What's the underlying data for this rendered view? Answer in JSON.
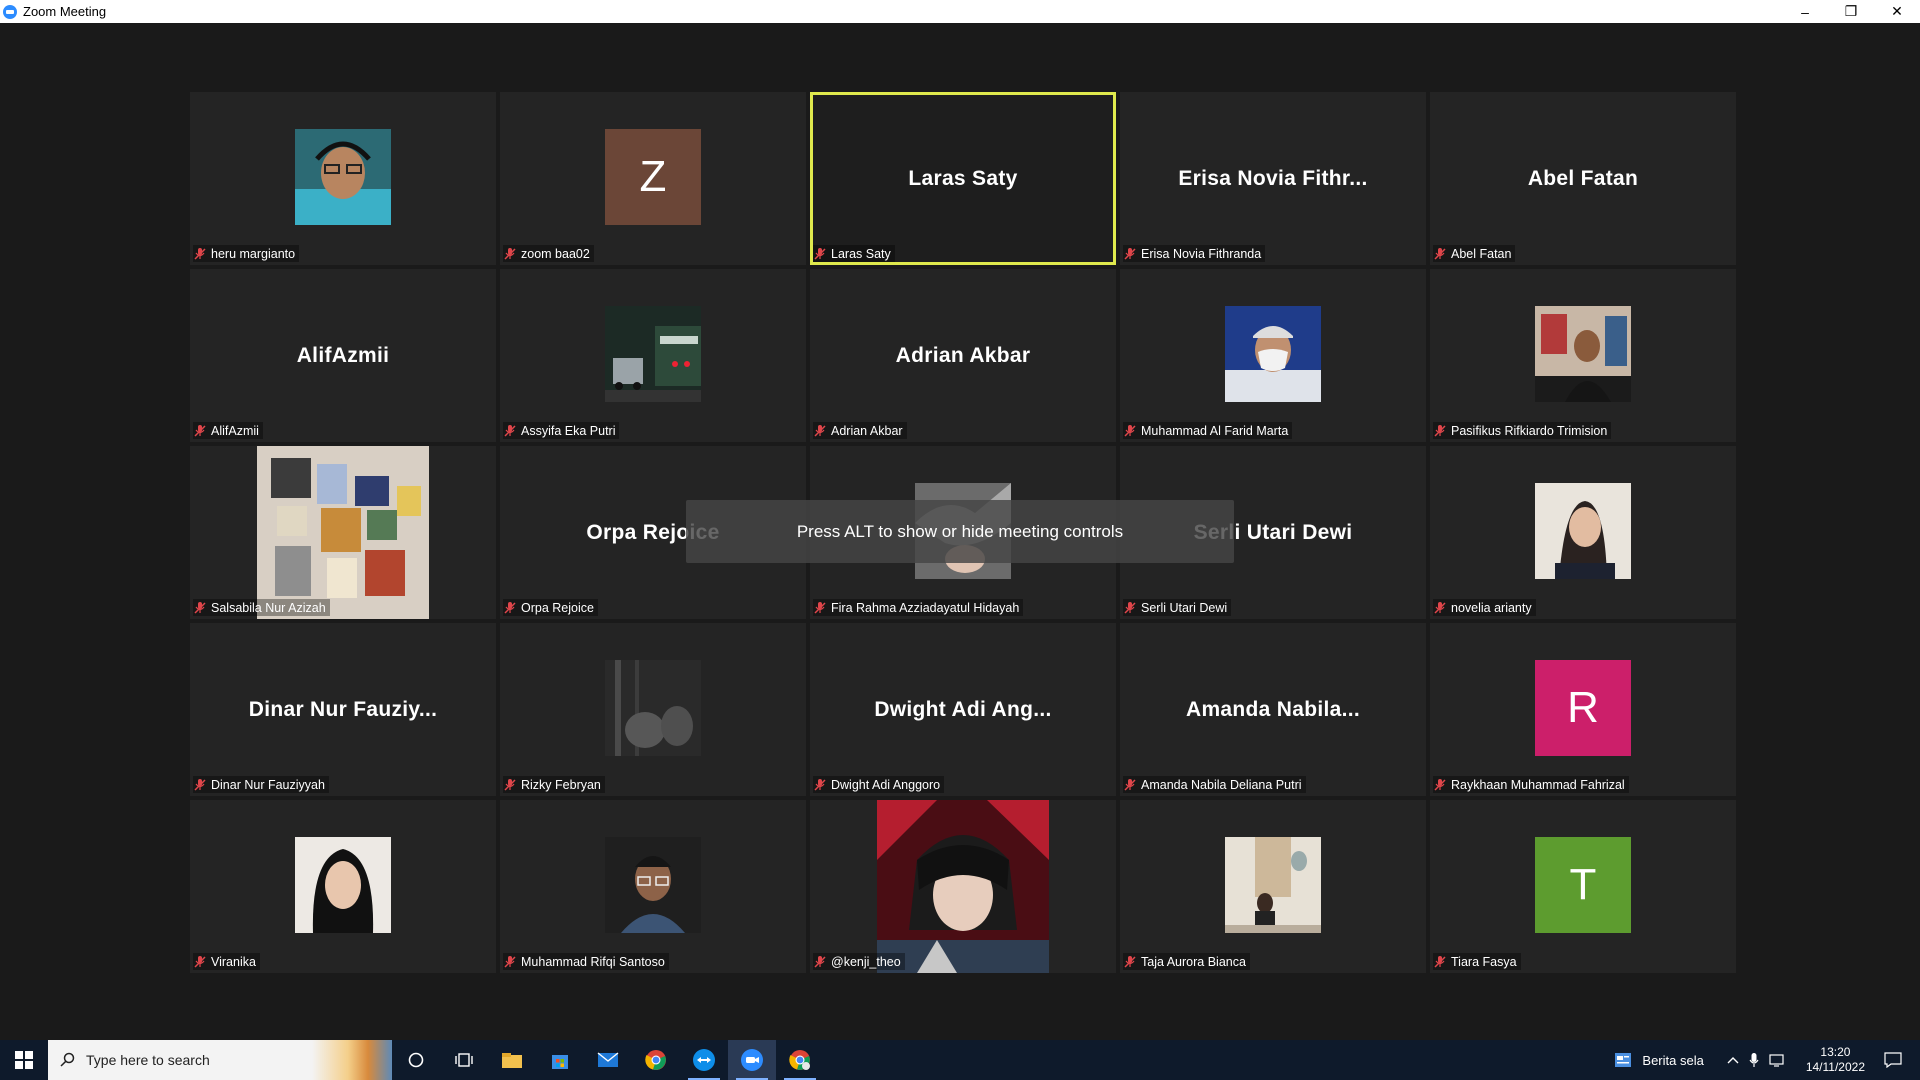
{
  "window": {
    "title": "Zoom Meeting",
    "minimize": "–",
    "restore": "❐",
    "close": "✕"
  },
  "overlay_message": "Press ALT to show or hide meeting controls",
  "participants": [
    {
      "name": "heru margianto",
      "display": "",
      "type": "photo",
      "photo": "heru"
    },
    {
      "name": "zoom baa02",
      "display": "Z",
      "type": "letter",
      "color": "#6b4637"
    },
    {
      "name": "Laras Saty",
      "display": "Laras Saty",
      "type": "text",
      "active": true
    },
    {
      "name": "Erisa Novia Fithranda",
      "display": "Erisa  Novia  Fithr...",
      "type": "text"
    },
    {
      "name": "Abel Fatan",
      "display": "Abel Fatan",
      "type": "text"
    },
    {
      "name": "AlifAzmii",
      "display": "AlifAzmii",
      "type": "text"
    },
    {
      "name": "Assyifa Eka Putri",
      "display": "",
      "type": "photo",
      "photo": "street"
    },
    {
      "name": "Adrian Akbar",
      "display": "Adrian Akbar",
      "type": "text"
    },
    {
      "name": "Muhammad Al Farid Marta",
      "display": "",
      "type": "photo",
      "photo": "masked"
    },
    {
      "name": "Pasifikus Rifkiardo Trimision",
      "display": "",
      "type": "photo",
      "photo": "room"
    },
    {
      "name": "Salsabila Nur Azizah",
      "display": "",
      "type": "photo",
      "photo": "wall"
    },
    {
      "name": "Orpa Rejoice",
      "display": "Orpa Rejoice",
      "type": "text"
    },
    {
      "name": "Fira Rahma Azziadayatul Hidayah",
      "display": "",
      "type": "photo",
      "photo": "fira"
    },
    {
      "name": "Serli Utari Dewi",
      "display": "Serli Utari Dewi",
      "type": "text"
    },
    {
      "name": "novelia arianty",
      "display": "",
      "type": "photo",
      "photo": "novelia"
    },
    {
      "name": "Dinar Nur Fauziyyah",
      "display": "Dinar  Nur  Fauziy...",
      "type": "text"
    },
    {
      "name": "Rizky Febryan",
      "display": "",
      "type": "photo",
      "photo": "dark"
    },
    {
      "name": "Dwight Adi Anggoro",
      "display": "Dwight  Adi  Ang...",
      "type": "text"
    },
    {
      "name": "Amanda Nabila Deliana Putri",
      "display": "Amanda  Nabila...",
      "type": "text"
    },
    {
      "name": "Raykhaan Muhammad Fahrizal",
      "display": "R",
      "type": "letter",
      "color": "#cc1f6a"
    },
    {
      "name": "Viranika",
      "display": "",
      "type": "photo",
      "photo": "hijab"
    },
    {
      "name": "Muhammad Rifqi Santoso",
      "display": "",
      "type": "photo",
      "photo": "glasses"
    },
    {
      "name": "@kenji_theo",
      "display": "",
      "type": "photo",
      "photo": "kenji"
    },
    {
      "name": "Taja Aurora Bianca",
      "display": "",
      "type": "photo",
      "photo": "taja"
    },
    {
      "name": "Tiara Fasya",
      "display": "T",
      "type": "letter",
      "color": "#5d9c2f"
    }
  ],
  "taskbar": {
    "search_placeholder": "Type here to search",
    "news": "Berita sela",
    "time": "13:20",
    "date": "14/11/2022",
    "apps": [
      "cortana-icon",
      "task-view-icon",
      "file-explorer-icon",
      "store-icon",
      "mail-icon",
      "chrome-icon",
      "teamviewer-icon",
      "zoom-icon",
      "chrome-alt-icon"
    ]
  }
}
